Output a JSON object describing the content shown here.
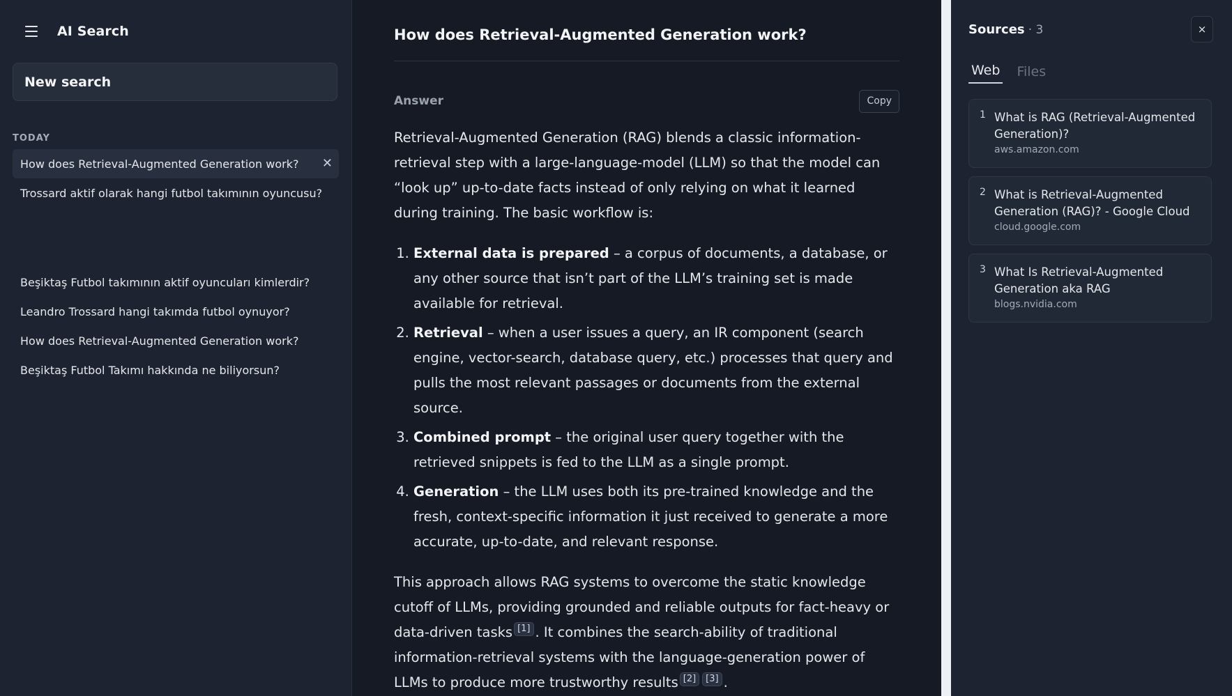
{
  "sidebar": {
    "app_title": "AI Search",
    "menu_icon": "hamburger-icon",
    "new_search_placeholder": "New search",
    "section_label": "TODAY",
    "today_items": [
      {
        "label": "How does Retrieval-Augmented Generation work?",
        "active": true
      },
      {
        "label": "Trossard aktif olarak hangi futbol takımının oyuncusu?",
        "active": false
      }
    ],
    "older_items": [
      {
        "label": "Beşiktaş Futbol takımının aktif oyuncuları kimlerdir?"
      },
      {
        "label": "Leandro Trossard hangi takımda futbol oynuyor?"
      },
      {
        "label": "How does Retrieval-Augmented Generation work?"
      },
      {
        "label": "Beşiktaş Futbol Takımı hakkında ne biliyorsun?"
      }
    ],
    "close_glyph": "✕"
  },
  "main": {
    "question": "How does Retrieval-Augmented Generation work?",
    "answer_label": "Answer",
    "copy_label": "Copy",
    "intro": "Retrieval-Augmented Generation (RAG) blends a classic information-retrieval step with a large-language-model (LLM) so that the model can “look up” up-to-date facts instead of only relying on what it learned during training. The basic workflow is:",
    "steps": [
      {
        "title": "External data is prepared",
        "text": " – a corpus of documents, a database, or any other source that isn’t part of the LLM’s training set is made available for retrieval."
      },
      {
        "title": "Retrieval",
        "text": " – when a user issues a query, an IR component (search engine, vector-search, database query, etc.) processes that query and pulls the most relevant passages or documents from the external source."
      },
      {
        "title": "Combined prompt",
        "text": " – the original user query together with the retrieved snippets is fed to the LLM as a single prompt."
      },
      {
        "title": "Generation",
        "text": " – the LLM uses both its pre-trained knowledge and the fresh, context-specific information it just received to generate a more accurate, up-to-date, and relevant response."
      }
    ],
    "conclusion_a": "This approach allows RAG systems to overcome the static knowledge cutoff of LLMs, providing grounded and reliable outputs for fact-heavy or data-driven tasks",
    "cite_1": "[1]",
    "conclusion_b": ". It combines the search-ability of traditional information-retrieval systems with the language-generation power of LLMs to produce more trustworthy results",
    "cite_2": "[2]",
    "cite_3": "[3]",
    "conclusion_end": "."
  },
  "sources": {
    "title": "Sources",
    "count": "· 3",
    "close_glyph": "×",
    "tabs": [
      {
        "label": "Web",
        "active": true
      },
      {
        "label": "Files",
        "active": false
      }
    ],
    "items": [
      {
        "num": "1",
        "title": "What is RAG (Retrieval-Augmented Generation)?",
        "domain": "aws.amazon.com"
      },
      {
        "num": "2",
        "title": "What is Retrieval-Augmented Generation (RAG)? - Google Cloud",
        "domain": "cloud.google.com"
      },
      {
        "num": "3",
        "title": "What Is Retrieval-Augmented Generation aka RAG",
        "domain": "blogs.nvidia.com"
      }
    ]
  },
  "colors": {
    "background": "#151a24",
    "sidebar": "#1d2330",
    "active_item": "#283040",
    "gutter": "#edf0f4"
  }
}
